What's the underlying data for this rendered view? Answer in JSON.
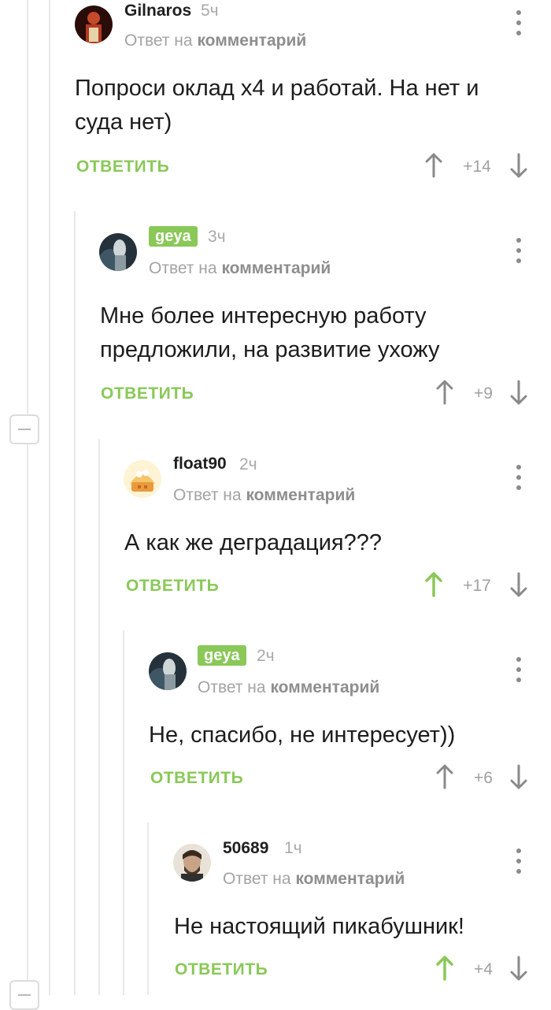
{
  "comments": [
    {
      "author": "Gilnaros",
      "time": "5ч",
      "reply_prefix": "Ответ на",
      "reply_target": "комментарий",
      "text": "Попроси оклад х4 и работай. На нет и суда нет)",
      "reply_label": "ОТВЕТИТЬ",
      "score": "+14",
      "upvoted": false
    },
    {
      "author": "geya",
      "time": "3ч",
      "reply_prefix": "Ответ на",
      "reply_target": "комментарий",
      "text": "Мне более интересную работу предложили, на развитие ухожу",
      "reply_label": "ОТВЕТИТЬ",
      "score": "+9",
      "upvoted": false
    },
    {
      "author": "float90",
      "time": "2ч",
      "reply_prefix": "Ответ на",
      "reply_target": "комментарий",
      "text": "А как же деградация???",
      "reply_label": "ОТВЕТИТЬ",
      "score": "+17",
      "upvoted": true
    },
    {
      "author": "geya",
      "time": "2ч",
      "reply_prefix": "Ответ на",
      "reply_target": "комментарий",
      "text": "Не, спасибо, не интересует))",
      "reply_label": "ОТВЕТИТЬ",
      "score": "+6",
      "upvoted": false
    },
    {
      "author": "50689",
      "time": "1ч",
      "reply_prefix": "Ответ на",
      "reply_target": "комментарий",
      "text": "Не настоящий пикабушник!",
      "reply_label": "ОТВЕТИТЬ",
      "score": "+4",
      "upvoted": true
    }
  ],
  "colors": {
    "accent_green": "#8ac858",
    "muted_gray": "#a3a3a3",
    "thread_line": "#e9e9e9"
  }
}
